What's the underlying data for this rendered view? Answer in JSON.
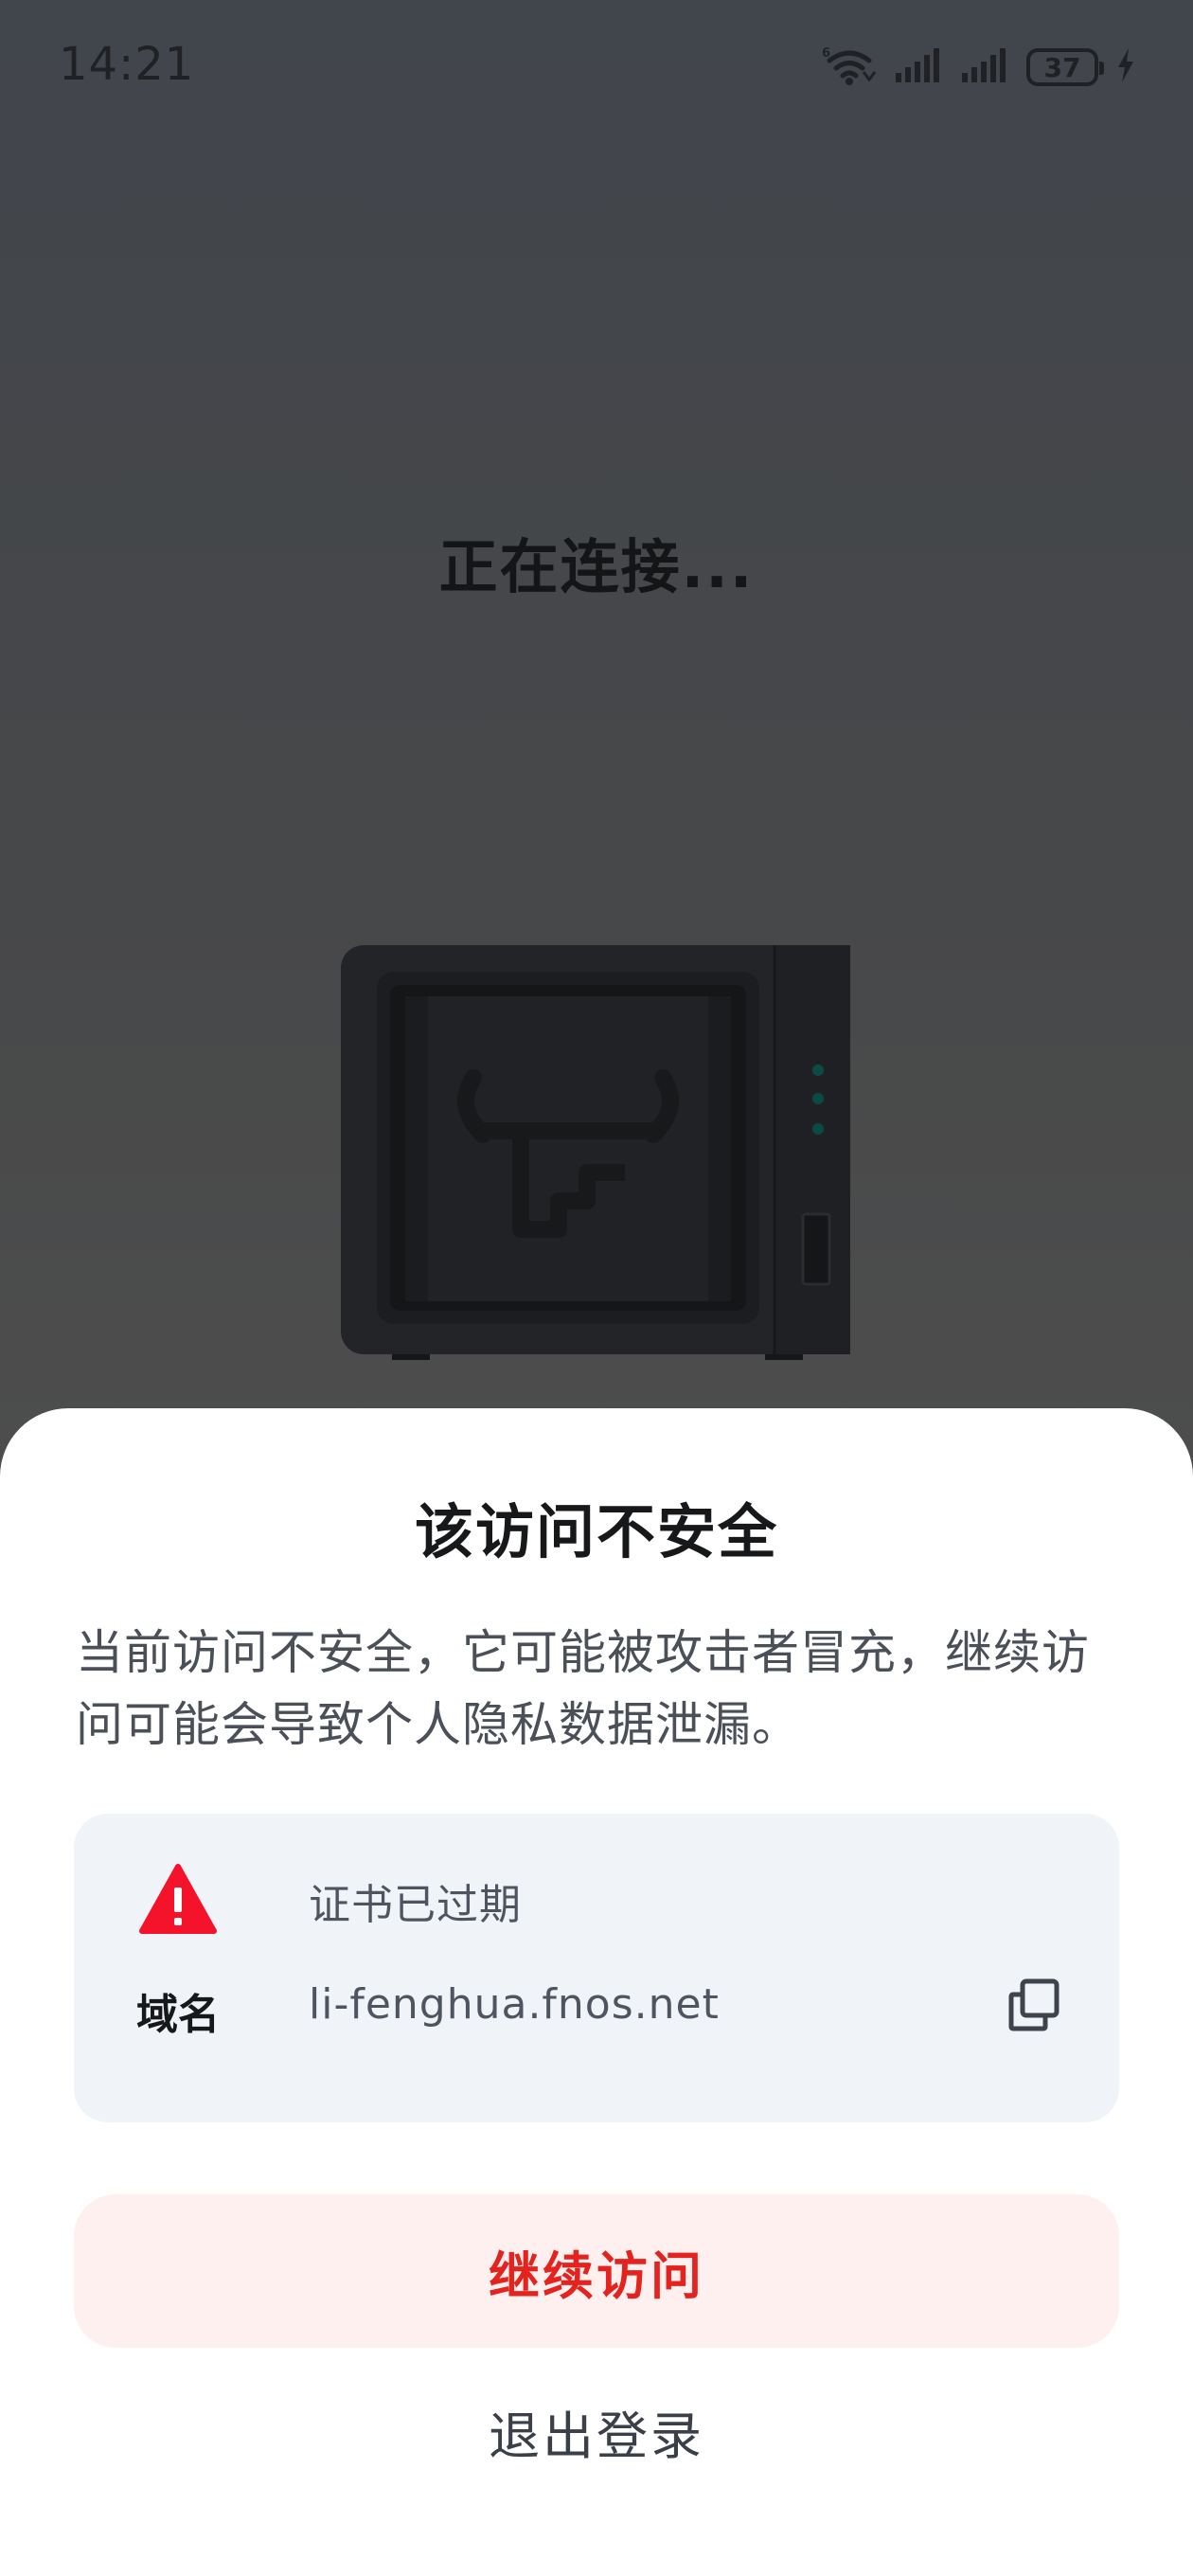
{
  "status_bar": {
    "time": "14:21",
    "battery": "37",
    "icons": [
      "wifi-6-icon",
      "signal-icon",
      "signal-icon",
      "battery-icon",
      "charging-icon"
    ]
  },
  "background": {
    "connecting_text": "正在连接..."
  },
  "dialog": {
    "title": "该访问不安全",
    "description": "当前访问不安全，它可能被攻击者冒充，继续访问可能会导致个人隐私数据泄漏。",
    "cert_status": "证书已过期",
    "domain_label": "域名",
    "domain_value": "li-fenghua.fnos.net",
    "continue_label": "继续访问",
    "logout_label": "退出登录"
  },
  "colors": {
    "danger": "#e4231f",
    "danger_bg": "#fff0f0",
    "card_bg": "#f0f3f8",
    "overlay": "#474849"
  }
}
